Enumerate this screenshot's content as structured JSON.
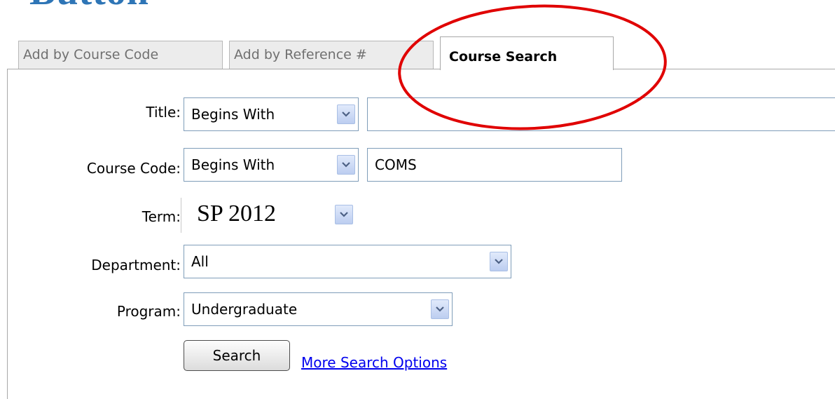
{
  "header": {
    "title": "Button"
  },
  "tabs": [
    {
      "label": "Add by Course Code",
      "active": false
    },
    {
      "label": "Add by Reference #",
      "active": false
    },
    {
      "label": "Course Search",
      "active": true
    }
  ],
  "form": {
    "title": {
      "label": "Title:",
      "match": "Begins With",
      "value": ""
    },
    "course_code": {
      "label": "Course Code:",
      "match": "Begins With",
      "value": "COMS"
    },
    "term": {
      "label": "Term:",
      "value": "SP 2012"
    },
    "department": {
      "label": "Department:",
      "value": "All"
    },
    "program": {
      "label": "Program:",
      "value": "Undergraduate"
    },
    "search_label": "Search",
    "more_options_label": "More Search Options"
  },
  "colors": {
    "heading": "#2e75b6",
    "annotation_circle": "#e00000",
    "link": "#0000ee"
  },
  "icons": {
    "dropdown": "chevron-down-icon"
  }
}
